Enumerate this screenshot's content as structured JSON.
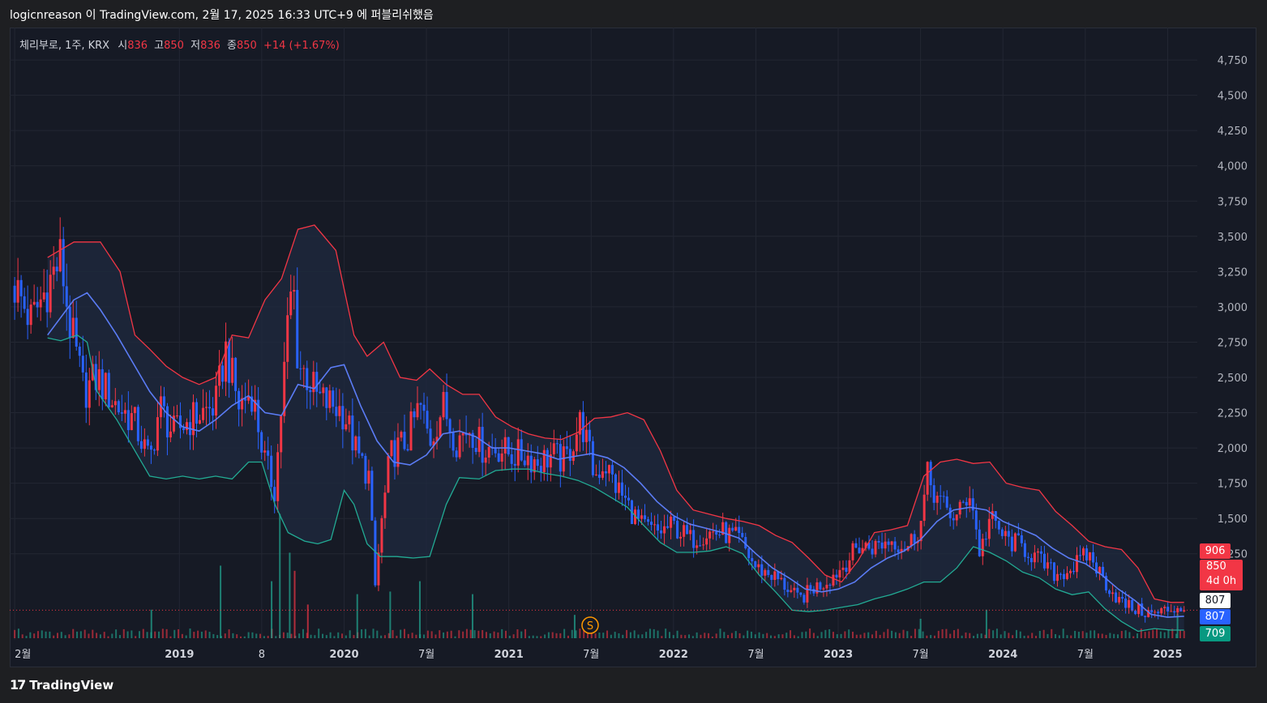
{
  "header": {
    "caption": "logicnreason 이 TradingView.com, 2월 17, 2025 16:33 UTC+9 에 퍼블리쉬했음"
  },
  "legend": {
    "symbol": "체리부로, 1주, KRX",
    "open_label": "시",
    "open": "836",
    "high_label": "고",
    "high": "850",
    "low_label": "저",
    "low": "836",
    "close_label": "종",
    "close": "850",
    "change": "+14 (+1.67%)"
  },
  "badges": {
    "upper_band": "906",
    "last_price": "850",
    "countdown": "4d 0h",
    "white_level": "807",
    "middle_band": "807",
    "lower_band": "709"
  },
  "footer": {
    "brand": "TradingView",
    "brand_mark": "17"
  },
  "colors": {
    "background": "#161a25",
    "up": "#f23645",
    "down": "#2962ff",
    "upper_band": "#f23645",
    "middle_band": "#5b7cf5",
    "lower_band": "#22ab94",
    "band_fill": "#1f2a3f"
  },
  "chart_data": {
    "type": "candlestick",
    "title": "체리부로, 1주, KRX",
    "indicator": "Bollinger Bands",
    "y_ticks": [
      1250,
      1500,
      1750,
      2000,
      2250,
      2500,
      2750,
      3000,
      3250,
      3500,
      3750,
      4000,
      4250,
      4500,
      4750
    ],
    "y_tick_labels": [
      "1,250",
      "1,500",
      "1,750",
      "2,000",
      "2,250",
      "2,500",
      "2,750",
      "3,000",
      "3,250",
      "3,500",
      "3,750",
      "4,000",
      "4,250",
      "4,500",
      "4,750"
    ],
    "ylim": [
      640,
      4980
    ],
    "x_labels": [
      {
        "t": 0.0,
        "label": "2월"
      },
      {
        "t": 10.0,
        "label": "2019"
      },
      {
        "t": 15.0,
        "label": "8"
      },
      {
        "t": 20.0,
        "label": "2020"
      },
      {
        "t": 25.0,
        "label": "7월"
      },
      {
        "t": 30.0,
        "label": "2021"
      },
      {
        "t": 35.0,
        "label": "7월"
      },
      {
        "t": 40.0,
        "label": "2022"
      },
      {
        "t": 45.0,
        "label": "7월"
      },
      {
        "t": 50.0,
        "label": "2023"
      },
      {
        "t": 55.0,
        "label": "7월"
      },
      {
        "t": 60.0,
        "label": "2024"
      },
      {
        "t": 65.0,
        "label": "7월"
      },
      {
        "t": 70.0,
        "label": "2025"
      }
    ],
    "x_range": [
      -0.3,
      71.8
    ],
    "price_path": [
      [
        0.0,
        3150
      ],
      [
        1.0,
        2900
      ],
      [
        2.0,
        3150
      ],
      [
        2.8,
        3350
      ],
      [
        3.3,
        2900
      ],
      [
        4.2,
        2400
      ],
      [
        5.0,
        2500
      ],
      [
        6.2,
        2300
      ],
      [
        7.2,
        2200
      ],
      [
        8.2,
        1900
      ],
      [
        8.8,
        2300
      ],
      [
        9.6,
        2100
      ],
      [
        10.6,
        2200
      ],
      [
        11.4,
        2250
      ],
      [
        12.2,
        2300
      ],
      [
        12.8,
        2700
      ],
      [
        13.6,
        2300
      ],
      [
        14.4,
        2400
      ],
      [
        15.2,
        1900
      ],
      [
        15.8,
        1700
      ],
      [
        16.6,
        2900
      ],
      [
        16.9,
        3200
      ],
      [
        17.2,
        2600
      ],
      [
        17.8,
        2500
      ],
      [
        18.4,
        2350
      ],
      [
        19.4,
        2300
      ],
      [
        20.0,
        2250
      ],
      [
        20.8,
        1950
      ],
      [
        21.5,
        1800
      ],
      [
        21.9,
        1000
      ],
      [
        22.2,
        1400
      ],
      [
        22.8,
        1950
      ],
      [
        23.8,
        2050
      ],
      [
        24.6,
        2300
      ],
      [
        25.2,
        2050
      ],
      [
        26.0,
        2300
      ],
      [
        26.8,
        2050
      ],
      [
        27.6,
        2150
      ],
      [
        28.4,
        2000
      ],
      [
        29.4,
        2000
      ],
      [
        30.2,
        1950
      ],
      [
        31.0,
        1950
      ],
      [
        31.8,
        1900
      ],
      [
        32.6,
        1950
      ],
      [
        33.4,
        1900
      ],
      [
        34.4,
        2200
      ],
      [
        35.2,
        1800
      ],
      [
        35.8,
        1900
      ],
      [
        36.4,
        1750
      ],
      [
        37.2,
        1600
      ],
      [
        38.0,
        1450
      ],
      [
        39.0,
        1400
      ],
      [
        40.0,
        1450
      ],
      [
        41.0,
        1350
      ],
      [
        42.0,
        1400
      ],
      [
        43.0,
        1400
      ],
      [
        44.0,
        1350
      ],
      [
        45.0,
        1150
      ],
      [
        46.0,
        1100
      ],
      [
        47.0,
        1000
      ],
      [
        47.6,
        920
      ],
      [
        48.4,
        1000
      ],
      [
        49.2,
        1050
      ],
      [
        50.2,
        1150
      ],
      [
        51.2,
        1300
      ],
      [
        52.2,
        1300
      ],
      [
        53.2,
        1350
      ],
      [
        54.2,
        1300
      ],
      [
        55.0,
        1450
      ],
      [
        55.4,
        1800
      ],
      [
        56.2,
        1600
      ],
      [
        57.2,
        1500
      ],
      [
        58.0,
        1700
      ],
      [
        58.6,
        1250
      ],
      [
        59.2,
        1500
      ],
      [
        60.2,
        1350
      ],
      [
        61.2,
        1300
      ],
      [
        62.2,
        1200
      ],
      [
        63.2,
        1100
      ],
      [
        64.2,
        1150
      ],
      [
        65.2,
        1250
      ],
      [
        66.2,
        1050
      ],
      [
        67.2,
        900
      ],
      [
        68.2,
        850
      ],
      [
        69.2,
        820
      ],
      [
        69.9,
        850
      ],
      [
        70.6,
        870
      ],
      [
        71.0,
        850
      ]
    ],
    "upper_band_path": [
      [
        2.0,
        3350
      ],
      [
        3.6,
        3460
      ],
      [
        5.2,
        3460
      ],
      [
        6.4,
        3250
      ],
      [
        7.3,
        2800
      ],
      [
        8.2,
        2700
      ],
      [
        9.2,
        2580
      ],
      [
        10.2,
        2500
      ],
      [
        11.2,
        2450
      ],
      [
        12.2,
        2500
      ],
      [
        13.2,
        2800
      ],
      [
        14.2,
        2780
      ],
      [
        15.2,
        3050
      ],
      [
        16.2,
        3200
      ],
      [
        17.2,
        3550
      ],
      [
        18.2,
        3580
      ],
      [
        19.5,
        3400
      ],
      [
        20.6,
        2800
      ],
      [
        21.4,
        2650
      ],
      [
        22.4,
        2750
      ],
      [
        23.4,
        2500
      ],
      [
        24.4,
        2480
      ],
      [
        25.2,
        2560
      ],
      [
        26.2,
        2450
      ],
      [
        27.2,
        2380
      ],
      [
        28.2,
        2380
      ],
      [
        29.2,
        2220
      ],
      [
        30.2,
        2150
      ],
      [
        31.2,
        2100
      ],
      [
        32.2,
        2070
      ],
      [
        33.2,
        2060
      ],
      [
        34.2,
        2110
      ],
      [
        35.2,
        2210
      ],
      [
        36.2,
        2220
      ],
      [
        37.2,
        2250
      ],
      [
        38.2,
        2200
      ],
      [
        39.2,
        1980
      ],
      [
        40.2,
        1700
      ],
      [
        41.2,
        1560
      ],
      [
        42.2,
        1530
      ],
      [
        43.2,
        1500
      ],
      [
        44.2,
        1480
      ],
      [
        45.2,
        1450
      ],
      [
        46.2,
        1380
      ],
      [
        47.2,
        1330
      ],
      [
        48.2,
        1220
      ],
      [
        49.2,
        1100
      ],
      [
        50.2,
        1050
      ],
      [
        51.2,
        1200
      ],
      [
        52.2,
        1400
      ],
      [
        53.2,
        1420
      ],
      [
        54.2,
        1450
      ],
      [
        55.2,
        1800
      ],
      [
        56.2,
        1900
      ],
      [
        57.2,
        1920
      ],
      [
        58.2,
        1890
      ],
      [
        59.2,
        1900
      ],
      [
        60.2,
        1750
      ],
      [
        61.2,
        1720
      ],
      [
        62.2,
        1700
      ],
      [
        63.2,
        1550
      ],
      [
        64.2,
        1450
      ],
      [
        65.2,
        1340
      ],
      [
        66.2,
        1300
      ],
      [
        67.2,
        1280
      ],
      [
        68.2,
        1150
      ],
      [
        69.2,
        930
      ],
      [
        70.2,
        905
      ],
      [
        71.0,
        906
      ]
    ],
    "middle_band_path": [
      [
        2.0,
        2800
      ],
      [
        3.6,
        3050
      ],
      [
        4.4,
        3100
      ],
      [
        5.2,
        2980
      ],
      [
        6.2,
        2800
      ],
      [
        7.2,
        2600
      ],
      [
        8.2,
        2400
      ],
      [
        9.2,
        2250
      ],
      [
        10.2,
        2150
      ],
      [
        11.2,
        2120
      ],
      [
        12.2,
        2200
      ],
      [
        13.2,
        2300
      ],
      [
        14.2,
        2370
      ],
      [
        15.2,
        2250
      ],
      [
        16.2,
        2230
      ],
      [
        17.2,
        2450
      ],
      [
        18.2,
        2420
      ],
      [
        19.2,
        2570
      ],
      [
        20.0,
        2590
      ],
      [
        21.0,
        2300
      ],
      [
        22.0,
        2050
      ],
      [
        23.0,
        1900
      ],
      [
        24.0,
        1880
      ],
      [
        25.0,
        1950
      ],
      [
        26.0,
        2100
      ],
      [
        27.0,
        2120
      ],
      [
        28.0,
        2080
      ],
      [
        29.0,
        2000
      ],
      [
        30.0,
        2000
      ],
      [
        31.0,
        1980
      ],
      [
        32.0,
        1960
      ],
      [
        33.0,
        1920
      ],
      [
        34.0,
        1940
      ],
      [
        35.0,
        1960
      ],
      [
        36.0,
        1930
      ],
      [
        37.0,
        1860
      ],
      [
        38.0,
        1750
      ],
      [
        39.0,
        1620
      ],
      [
        40.0,
        1520
      ],
      [
        41.0,
        1460
      ],
      [
        42.0,
        1430
      ],
      [
        43.0,
        1400
      ],
      [
        44.0,
        1360
      ],
      [
        45.0,
        1250
      ],
      [
        46.0,
        1150
      ],
      [
        47.0,
        1080
      ],
      [
        48.0,
        1000
      ],
      [
        49.0,
        980
      ],
      [
        50.0,
        1000
      ],
      [
        51.0,
        1050
      ],
      [
        52.0,
        1150
      ],
      [
        53.0,
        1220
      ],
      [
        54.0,
        1270
      ],
      [
        55.0,
        1350
      ],
      [
        56.0,
        1480
      ],
      [
        57.0,
        1560
      ],
      [
        58.0,
        1580
      ],
      [
        59.0,
        1560
      ],
      [
        60.0,
        1480
      ],
      [
        61.0,
        1430
      ],
      [
        62.0,
        1380
      ],
      [
        63.0,
        1290
      ],
      [
        64.0,
        1220
      ],
      [
        65.0,
        1180
      ],
      [
        66.0,
        1100
      ],
      [
        67.0,
        1000
      ],
      [
        68.0,
        920
      ],
      [
        69.0,
        820
      ],
      [
        70.0,
        800
      ],
      [
        71.0,
        807
      ]
    ],
    "lower_band_path": [
      [
        2.0,
        2780
      ],
      [
        2.8,
        2760
      ],
      [
        3.8,
        2800
      ],
      [
        4.4,
        2750
      ],
      [
        5.0,
        2400
      ],
      [
        6.2,
        2200
      ],
      [
        7.2,
        2000
      ],
      [
        8.2,
        1800
      ],
      [
        9.2,
        1780
      ],
      [
        10.2,
        1800
      ],
      [
        11.2,
        1780
      ],
      [
        12.2,
        1800
      ],
      [
        13.2,
        1780
      ],
      [
        14.2,
        1900
      ],
      [
        15.0,
        1900
      ],
      [
        15.8,
        1600
      ],
      [
        16.6,
        1400
      ],
      [
        17.6,
        1340
      ],
      [
        18.4,
        1320
      ],
      [
        19.2,
        1350
      ],
      [
        20.0,
        1700
      ],
      [
        20.6,
        1600
      ],
      [
        21.4,
        1320
      ],
      [
        22.2,
        1230
      ],
      [
        23.2,
        1230
      ],
      [
        24.2,
        1220
      ],
      [
        25.2,
        1230
      ],
      [
        26.2,
        1600
      ],
      [
        27.0,
        1790
      ],
      [
        28.2,
        1780
      ],
      [
        29.2,
        1840
      ],
      [
        30.2,
        1850
      ],
      [
        31.2,
        1850
      ],
      [
        32.2,
        1820
      ],
      [
        33.2,
        1800
      ],
      [
        34.2,
        1770
      ],
      [
        35.2,
        1720
      ],
      [
        36.2,
        1650
      ],
      [
        37.2,
        1580
      ],
      [
        38.2,
        1450
      ],
      [
        39.2,
        1330
      ],
      [
        40.2,
        1260
      ],
      [
        41.2,
        1260
      ],
      [
        42.2,
        1270
      ],
      [
        43.2,
        1300
      ],
      [
        44.2,
        1250
      ],
      [
        45.2,
        1100
      ],
      [
        46.2,
        980
      ],
      [
        47.2,
        850
      ],
      [
        48.2,
        840
      ],
      [
        49.2,
        850
      ],
      [
        50.2,
        870
      ],
      [
        51.2,
        890
      ],
      [
        52.2,
        930
      ],
      [
        53.2,
        960
      ],
      [
        54.2,
        1000
      ],
      [
        55.2,
        1050
      ],
      [
        56.2,
        1050
      ],
      [
        57.2,
        1150
      ],
      [
        58.2,
        1300
      ],
      [
        59.2,
        1260
      ],
      [
        60.2,
        1200
      ],
      [
        61.2,
        1120
      ],
      [
        62.2,
        1080
      ],
      [
        63.2,
        1000
      ],
      [
        64.2,
        960
      ],
      [
        65.2,
        980
      ],
      [
        66.2,
        860
      ],
      [
        67.2,
        770
      ],
      [
        68.2,
        700
      ],
      [
        69.2,
        720
      ],
      [
        70.2,
        709
      ],
      [
        71.0,
        709
      ]
    ],
    "volume_spikes": [
      [
        8.3,
        0.22,
        1
      ],
      [
        12.5,
        0.56,
        1
      ],
      [
        15.6,
        0.44,
        1
      ],
      [
        16.1,
        0.96,
        1
      ],
      [
        16.7,
        0.66,
        1
      ],
      [
        17.0,
        0.52,
        0
      ],
      [
        17.8,
        0.26,
        0
      ],
      [
        20.8,
        0.34,
        1
      ],
      [
        22.8,
        0.36,
        1
      ],
      [
        24.6,
        0.44,
        1
      ],
      [
        27.8,
        0.34,
        1
      ],
      [
        34.0,
        0.18,
        1
      ],
      [
        55.0,
        0.15,
        1
      ],
      [
        59.0,
        0.22,
        1
      ],
      [
        70.6,
        0.19,
        1
      ]
    ],
    "last_close": 850
  }
}
